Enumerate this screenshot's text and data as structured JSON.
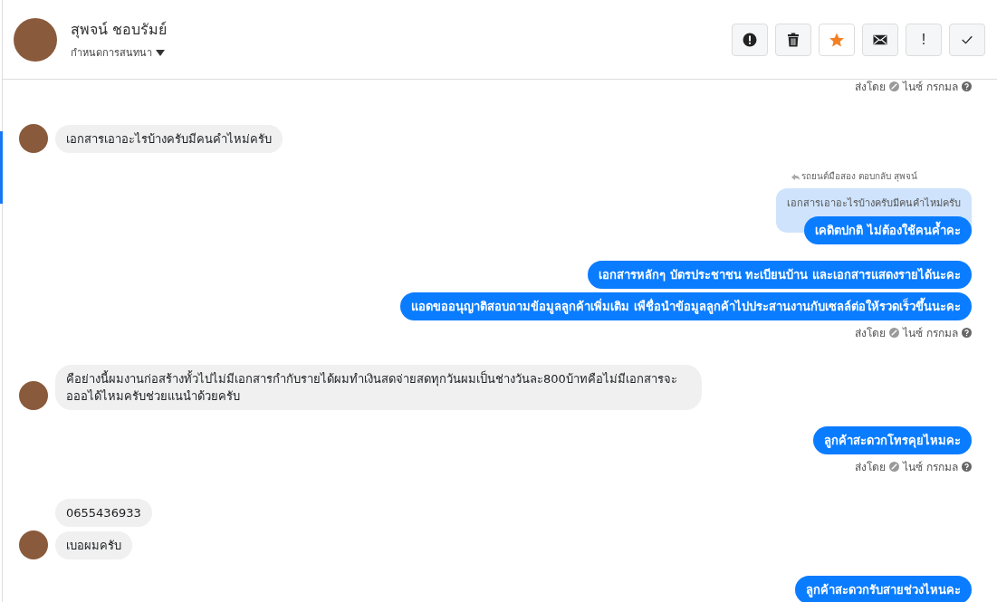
{
  "header": {
    "name": "สุพจน์ ชอบรัมย์",
    "subtitle": "กำหนดการสนทนา ",
    "actions": [
      {
        "kind": "alert",
        "selected": false
      },
      {
        "kind": "trash",
        "selected": false
      },
      {
        "kind": "star",
        "selected": true
      },
      {
        "kind": "mail",
        "selected": false
      },
      {
        "kind": "text",
        "label": "!",
        "selected": false
      },
      {
        "kind": "check",
        "selected": false
      }
    ]
  },
  "messages": [
    {
      "kind": "meta",
      "prefix": "ส่งโดย",
      "agent": "ไนซ์ กรกมล"
    },
    {
      "kind": "incoming",
      "avatar": true,
      "text": "เอกสารเอาอะไรบ้างครับมีคนคำไหม่ครับ"
    },
    {
      "kind": "reply",
      "label": "รถยนต์มือสอง ตอบกลับ สุพจน์",
      "quote": "เอกสารเอาอะไรบ้างครับมีคนคำไหม่ครับ",
      "text": "เคดิตปกติ ไม่ต้องใช้คนค้ำคะ"
    },
    {
      "kind": "outgoing",
      "text": "เอกสารหลักๆ บัตรประชาชน ทะเบียนบ้าน  และเอกสารแสดงรายได้นะคะ"
    },
    {
      "kind": "outgoing",
      "text": "แอดขออนุญาติสอบถามข้อมูลลูกค้าเพิ่มเติม เพืชื่อนำข้อมูลลูกค้าไปประสานงานกับเซลล์ต่อให้รวดเร็วขึ้นนะคะ"
    },
    {
      "kind": "meta",
      "prefix": "ส่งโดย",
      "agent": "ไนซ์ กรกมล"
    },
    {
      "kind": "incoming",
      "avatar": true,
      "text": "คือย่างนี้ผมงานก่อสร้างทั้วไปไม่มีเอกสารกำกับรายได้ผมทำเงินสดจ่ายสดทุกวันผมเป็นช่างวันละ800บ้าทคือไม่มีเอกสารจะอออได้ไหมครับช่วยแนนำด้วยครับ"
    },
    {
      "kind": "outgoing",
      "text": "ลูกค้าสะดวกโทรคุยไหมคะ"
    },
    {
      "kind": "meta",
      "prefix": "ส่งโดย",
      "agent": "ไนซ์ กรกมล"
    },
    {
      "kind": "incoming",
      "avatar": false,
      "text": "0655436933"
    },
    {
      "kind": "incoming",
      "avatar": true,
      "text": "เบอผมครับ"
    },
    {
      "kind": "outgoing",
      "text": "ลูกค้าสะดวกรับสายช่วงไหนคะ"
    }
  ]
}
